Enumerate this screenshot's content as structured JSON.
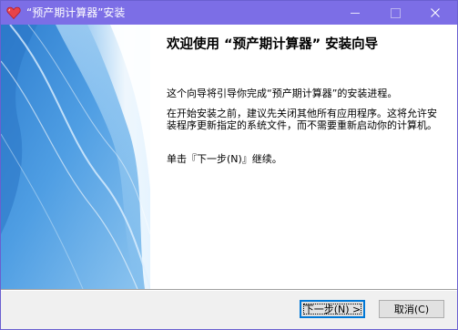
{
  "window": {
    "title": "“预产期计算器”安装",
    "app_icon": "heart-icon",
    "title_bar_color": "#7c6ee6"
  },
  "titlebar_buttons": {
    "minimize_icon": "minimize-icon",
    "maximize_icon": "maximize-icon",
    "close_icon": "close-icon"
  },
  "content": {
    "heading": "欢迎使用 “预产期计算器” 安装向导",
    "para1": "这个向导将引导你完成“预产期计算器”的安装进程。",
    "para2": "在开始安装之前，建议先关闭其他所有应用程序。这将允许安装程序更新指定的系统文件，而不需要重新启动你的计算机。",
    "para3": "单击『下一步(N)』继续。"
  },
  "buttons": {
    "next_label": "下一步(N) >",
    "cancel_label": "取消(C)"
  },
  "colors": {
    "accent_focus": "#0078d7",
    "banner_blue": "#3f8fd8"
  }
}
